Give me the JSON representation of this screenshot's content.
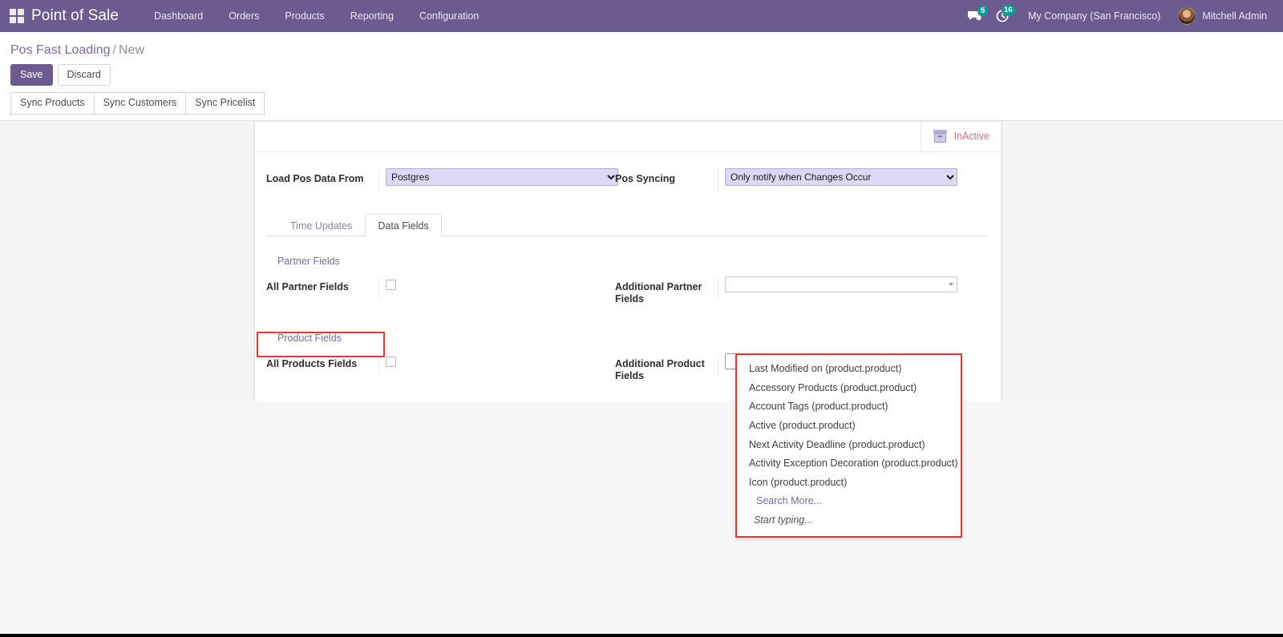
{
  "navbar": {
    "apps_icon": "apps-grid-icon",
    "brand": "Point of Sale",
    "menu": [
      {
        "label": "Dashboard"
      },
      {
        "label": "Orders"
      },
      {
        "label": "Products"
      },
      {
        "label": "Reporting"
      },
      {
        "label": "Configuration"
      }
    ],
    "messages_icon": "chat-bubble-icon",
    "messages_count": "5",
    "activities_icon": "clock-icon",
    "activities_count": "16",
    "company": "My Company (San Francisco)",
    "avatar": "user-avatar",
    "user": "Mitchell Admin"
  },
  "control_panel": {
    "breadcrumb_parent": "Pos Fast Loading",
    "breadcrumb_separator": "/",
    "breadcrumb_current": "New",
    "save_label": "Save",
    "discard_label": "Discard",
    "actions": [
      {
        "label": "Sync Products"
      },
      {
        "label": "Sync Customers"
      },
      {
        "label": "Sync Pricelist"
      }
    ]
  },
  "form": {
    "status_icon": "archive-box-icon",
    "status_label": "InActive",
    "status_color": "#e0707a",
    "fields": {
      "load_pos_data_from_label": "Load Pos Data From",
      "load_pos_data_from_value": "Postgres",
      "load_pos_data_from_options": [
        "Postgres"
      ],
      "pos_syncing_label": "Pos Syncing",
      "pos_syncing_value": "Only notify when Changes Occur",
      "pos_syncing_options": [
        "Only notify when Changes Occur"
      ]
    },
    "tabs": [
      {
        "label": "Time Updates",
        "active": false
      },
      {
        "label": "Data Fields",
        "active": true
      }
    ],
    "partner_group_title": "Partner Fields",
    "all_partner_fields_label": "All Partner Fields",
    "additional_partner_fields_label": "Additional Partner Fields",
    "additional_partner_fields_value": "",
    "product_group_title": "Product Fields",
    "all_products_fields_label": "All Products Fields",
    "additional_product_fields_label": "Additional Product Fields",
    "additional_product_fields_value": ""
  },
  "dropdown": {
    "options": [
      {
        "label": "Last Modified on (product.product)",
        "kind": "option"
      },
      {
        "label": "Accessory Products (product.product)",
        "kind": "option"
      },
      {
        "label": "Account Tags (product.product)",
        "kind": "option"
      },
      {
        "label": "Active (product.product)",
        "kind": "option"
      },
      {
        "label": "Next Activity Deadline (product.product)",
        "kind": "option"
      },
      {
        "label": "Activity Exception Decoration (product.product)",
        "kind": "option"
      },
      {
        "label": "Icon (product.product)",
        "kind": "option"
      },
      {
        "label": "Search More...",
        "kind": "link"
      },
      {
        "label": "Start typing...",
        "kind": "hint"
      }
    ]
  },
  "annotations": {
    "highlight_color": "#f0322e"
  }
}
